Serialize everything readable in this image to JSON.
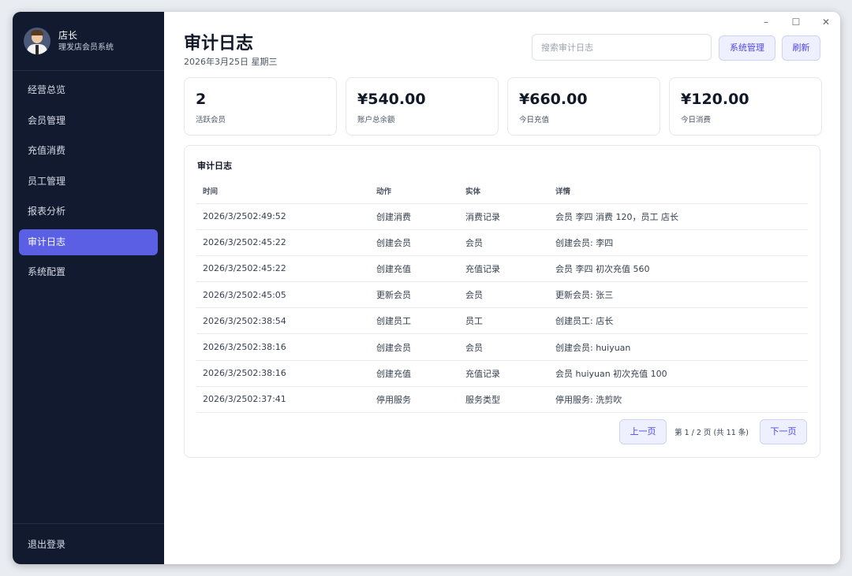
{
  "profile": {
    "name": "店长",
    "subtitle": "理发店会员系统"
  },
  "nav": [
    {
      "label": "经营总览"
    },
    {
      "label": "会员管理"
    },
    {
      "label": "充值消费"
    },
    {
      "label": "员工管理"
    },
    {
      "label": "报表分析"
    },
    {
      "label": "审计日志",
      "active": true
    },
    {
      "label": "系统配置"
    }
  ],
  "logout_label": "退出登录",
  "window_controls": {
    "minimize": "–",
    "maximize": "☐",
    "close": "✕"
  },
  "header": {
    "title": "审计日志",
    "date": "2026年3月25日 星期三",
    "search_placeholder": "搜索审计日志",
    "system_button": "系统管理",
    "refresh_button": "刷新"
  },
  "stats": [
    {
      "value": "2",
      "label": "活跃会员"
    },
    {
      "value": "¥540.00",
      "label": "账户总余额"
    },
    {
      "value": "¥660.00",
      "label": "今日充值"
    },
    {
      "value": "¥120.00",
      "label": "今日消费"
    }
  ],
  "log_panel": {
    "title": "审计日志",
    "columns": [
      "时间",
      "动作",
      "实体",
      "详情"
    ],
    "rows": [
      [
        "2026/3/2502:49:52",
        "创建消费",
        "消费记录",
        "会员 李四 消费 120，员工 店长"
      ],
      [
        "2026/3/2502:45:22",
        "创建会员",
        "会员",
        "创建会员: 李四"
      ],
      [
        "2026/3/2502:45:22",
        "创建充值",
        "充值记录",
        "会员 李四 初次充值 560"
      ],
      [
        "2026/3/2502:45:05",
        "更新会员",
        "会员",
        "更新会员: 张三"
      ],
      [
        "2026/3/2502:38:54",
        "创建员工",
        "员工",
        "创建员工: 店长"
      ],
      [
        "2026/3/2502:38:16",
        "创建会员",
        "会员",
        "创建会员: huiyuan"
      ],
      [
        "2026/3/2502:38:16",
        "创建充值",
        "充值记录",
        "会员 huiyuan 初次充值 100"
      ],
      [
        "2026/3/2502:37:41",
        "停用服务",
        "服务类型",
        "停用服务: 洗剪吹"
      ]
    ],
    "prev_label": "上一页",
    "page_info": "第 1 / 2 页 (共 11 条)",
    "next_label": "下一页"
  },
  "colors": {
    "sidebar": "#111a2e",
    "accent": "#5b5fe3"
  }
}
